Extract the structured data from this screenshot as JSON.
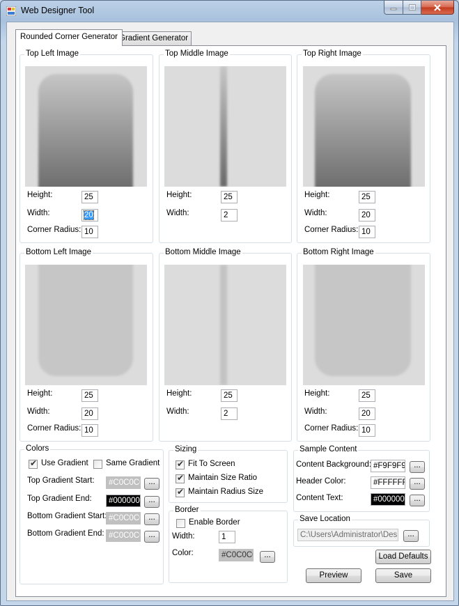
{
  "window": {
    "title": "Web Designer Tool"
  },
  "tabs": [
    {
      "label": "Rounded Corner Generator",
      "active": true
    },
    {
      "label": "Gradient Generator",
      "active": false
    }
  ],
  "images": {
    "top_left": {
      "title": "Top Left Image",
      "height": "25",
      "width": "20",
      "corner_radius": "10"
    },
    "top_middle": {
      "title": "Top Middle Image",
      "height": "25",
      "width": "2"
    },
    "top_right": {
      "title": "Top Right Image",
      "height": "25",
      "width": "20",
      "corner_radius": "10"
    },
    "bottom_left": {
      "title": "Bottom Left Image",
      "height": "25",
      "width": "20",
      "corner_radius": "10"
    },
    "bottom_middle": {
      "title": "Bottom Middle Image",
      "height": "25",
      "width": "2"
    },
    "bottom_right": {
      "title": "Bottom Right Image",
      "height": "25",
      "width": "20",
      "corner_radius": "10"
    }
  },
  "labels": {
    "height": "Height:",
    "width": "Width:",
    "corner_radius": "Corner Radius:"
  },
  "colors": {
    "title": "Colors",
    "use_gradient": "Use Gradient",
    "same_gradient": "Same Gradient",
    "top_start_label": "Top Gradient Start:",
    "top_start_value": "#C0C0C0",
    "top_end_label": "Top Gradient End:",
    "top_end_value": "#000000",
    "bottom_start_label": "Bottom Gradient Start:",
    "bottom_start_value": "#C0C0C0",
    "bottom_end_label": "Bottom Gradient End:",
    "bottom_end_value": "#C0C0C0"
  },
  "sizing": {
    "title": "Sizing",
    "fit_to_screen": "Fit To Screen",
    "maintain_size_ratio": "Maintain Size Ratio",
    "maintain_radius_size": "Maintain Radius Size"
  },
  "border": {
    "title": "Border",
    "enable_border": "Enable Border",
    "width_label": "Width:",
    "width_value": "1",
    "color_label": "Color:",
    "color_value": "#C0C0C0"
  },
  "sample": {
    "title": "Sample Content",
    "bg_label": "Content Background:",
    "bg_value": "#F9F9F9",
    "header_label": "Header Color:",
    "header_value": "#FFFFFF",
    "text_label": "Content Text:",
    "text_value": "#000000"
  },
  "save_location": {
    "title": "Save Location",
    "path": "C:\\Users\\Administrator\\Deskt"
  },
  "buttons": {
    "ellipsis": "...",
    "load_defaults": "Load Defaults",
    "preview": "Preview",
    "save": "Save"
  }
}
